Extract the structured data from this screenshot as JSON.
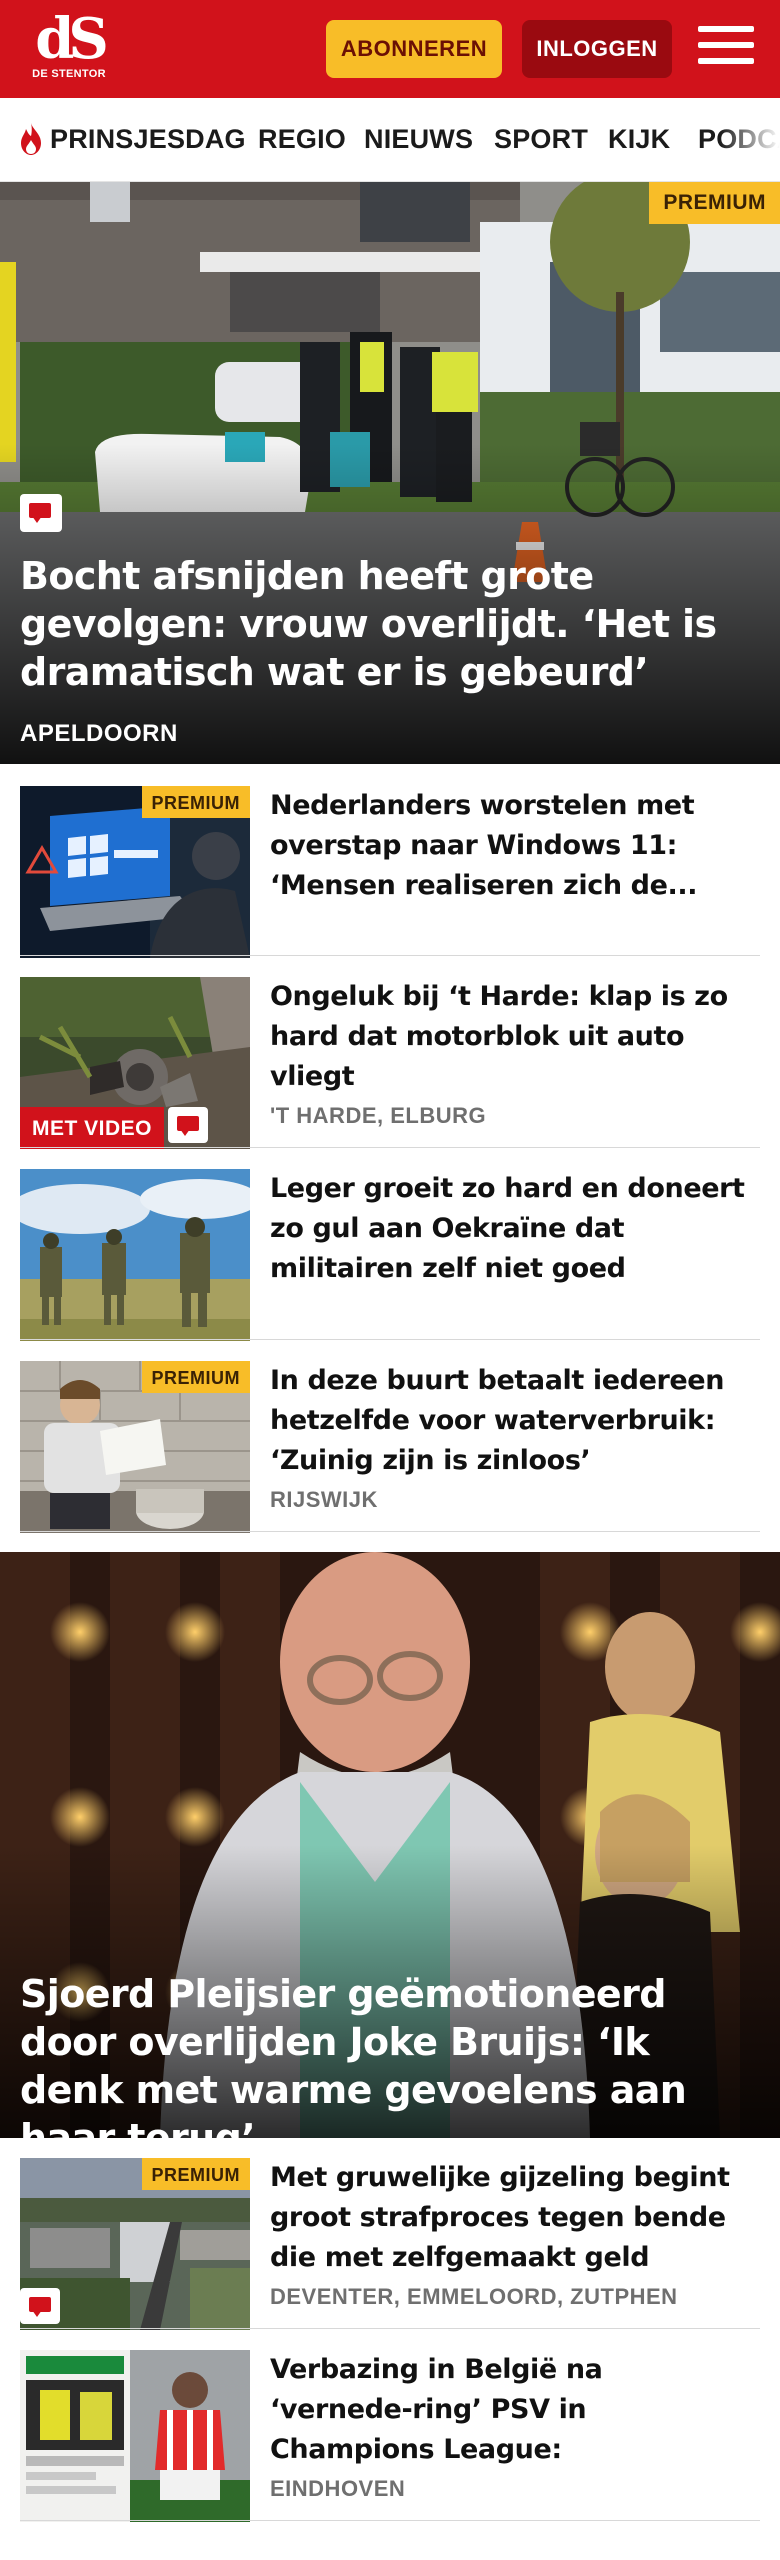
{
  "header": {
    "logo_mark": "dS",
    "logo_text": "DE STENTOR",
    "subscribe_label": "ABONNEREN",
    "login_label": "INLOGGEN",
    "brand_color": "#d1121b",
    "accent_color": "#f8bd28"
  },
  "nav": {
    "items": [
      "PRINSJESDAG",
      "REGIO",
      "NIEUWS",
      "SPORT",
      "KIJK",
      "PODCAST"
    ]
  },
  "hero1": {
    "title": "Bocht afsnijden heeft grote gevolgen: vrouw overlijdt. ‘Het is dramatisch wat er is gebeurd’",
    "location": "APELDOORN",
    "premium_label": "PREMIUM",
    "icon": "comment-icon"
  },
  "articles": [
    {
      "title": "Nederlanders worstelen met overstap naar Windows 11: ‘Mensen realiseren zich de...",
      "location": "",
      "premium_label": "PREMIUM",
      "video_label": ""
    },
    {
      "title": "Ongeluk bij ‘t Harde: klap is zo hard dat motorblok uit auto vliegt",
      "location": "'T HARDE, ELBURG",
      "premium_label": "",
      "video_label": "MET VIDEO"
    },
    {
      "title": "Leger groeit zo hard en doneert zo gul aan Oekraïne dat militairen zelf niet goed kunnen...",
      "location": "",
      "premium_label": "",
      "video_label": ""
    },
    {
      "title": "In deze buurt betaalt iedereen hetzelfde voor waterverbruik: ‘Zuinig zijn is zinloos’",
      "location": "RIJSWIJK",
      "premium_label": "PREMIUM",
      "video_label": ""
    }
  ],
  "hero2": {
    "title": "Sjoerd Pleijsier geëmotioneerd door overlijden Joke Bruijs: ‘Ik denk met warme gevoelens aan haar terug’"
  },
  "articles2": [
    {
      "title": "Met gruwelijke gijzeling begint groot strafproces tegen bende die met zelfgemaakt geld dure...",
      "location": "DEVENTER, EMMELOORD, ZUTPHEN",
      "premium_label": "PREMIUM"
    },
    {
      "title": "Verbazing in België na ‘vernede-ring’ PSV in Champions League: ‘Ongelofelijk, ze hebben zó’n...",
      "location": "EINDHOVEN",
      "premium_label": ""
    }
  ]
}
